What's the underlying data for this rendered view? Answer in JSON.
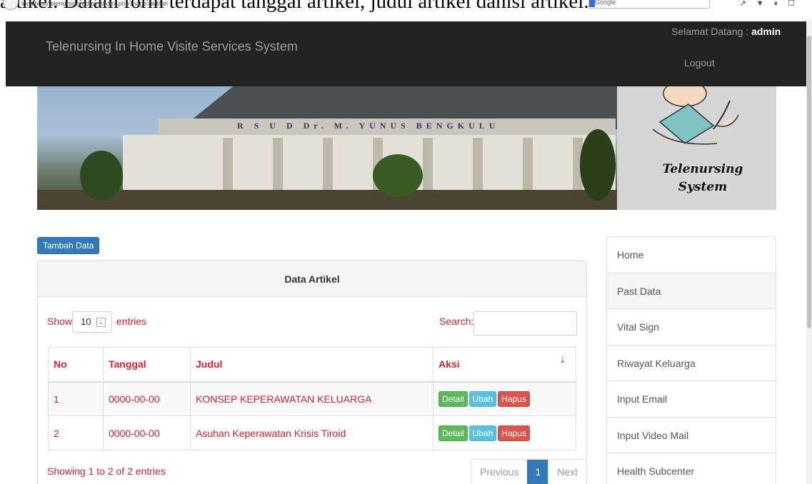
{
  "document": {
    "text_above": "artikel. Dalam form terdapat tanggal artikel, judul artikel danisi artikel."
  },
  "browser": {
    "url": "localhost/telenursing/admin/index.php?page=artikel",
    "search_engine": "Google"
  },
  "navbar": {
    "brand": "Telenursing In Home Visite Services System",
    "welcome_prefix": "Selamat Datang : ",
    "username": "admin",
    "logout_label": "Logout"
  },
  "banner": {
    "building_sign": "R S U D  Dr. M. YUNUS  BENGKULU",
    "title_line1": "Telenursing",
    "title_line2": "System"
  },
  "toolbar": {
    "add_label": "Tambah Data"
  },
  "panel": {
    "heading": "Data Artikel",
    "show_label": "Show",
    "entries_value": "10",
    "entries_label": "entries",
    "search_label": "Search:",
    "search_value": ""
  },
  "table": {
    "headers": [
      "No",
      "Tanggal",
      "Judul",
      "Aksi"
    ],
    "rows": [
      {
        "no": "1",
        "tanggal": "0000-00-00",
        "judul": "KONSEP KEPERAWATAN KELUARGA"
      },
      {
        "no": "2",
        "tanggal": "0000-00-00",
        "judul": "Asuhan Keperawatan Krisis Tiroid"
      }
    ],
    "actions": {
      "detail": "Detail",
      "ubah": "Ubah",
      "hapus": "Hapus"
    }
  },
  "footer": {
    "info": "Showing 1 to 2 of 2 entries",
    "previous": "Previous",
    "page": "1",
    "next": "Next"
  },
  "sidebar": {
    "items": [
      {
        "label": "Home"
      },
      {
        "label": "Past Data"
      },
      {
        "label": "Vital Sign"
      },
      {
        "label": "Riwayat Keluarga"
      },
      {
        "label": "Input Email"
      },
      {
        "label": "Input Video Mail"
      },
      {
        "label": "Health Subcenter"
      }
    ],
    "active": "Past Data"
  },
  "colors": {
    "navbar": "#222222",
    "primary": "#337ab7",
    "success": "#5cb85c",
    "info": "#5bc0de",
    "danger": "#d9534f",
    "link_text": "#d9232d"
  }
}
